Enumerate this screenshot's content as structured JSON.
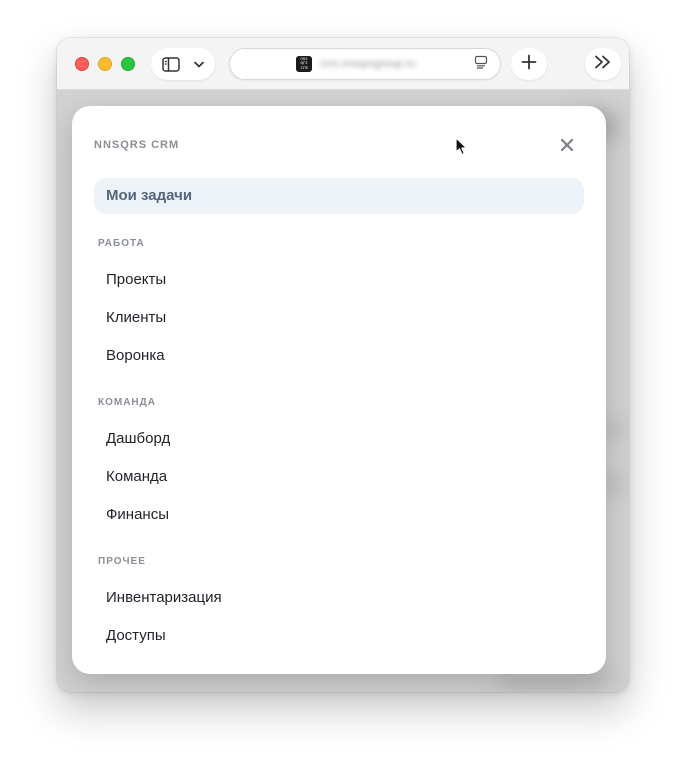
{
  "browser": {
    "address": "crm.nnsqrsgroup.ru",
    "favicon_text": "nns qrs crm"
  },
  "menu": {
    "brand": "NNSQRS CRM",
    "active_item": "Мои задачи",
    "sections": [
      {
        "label": "РАБОТА",
        "items": [
          "Проекты",
          "Клиенты",
          "Воронка"
        ]
      },
      {
        "label": "КОМАНДА",
        "items": [
          "Дашборд",
          "Команда",
          "Финансы"
        ]
      },
      {
        "label": "ПРОЧЕЕ",
        "items": [
          "Инвентаризация",
          "Доступы"
        ]
      }
    ]
  },
  "icons": {
    "close": "close-icon",
    "sidebar": "sidebar-icon",
    "chevron": "chevron-down-icon",
    "reader": "reader-icon",
    "plus": "plus-icon",
    "more_tabs": "double-chevron-right-icon",
    "cursor": "mouse-pointer-icon"
  },
  "colors": {
    "active_bg": "#eef3f8",
    "active_text": "#52677d",
    "section_label": "#8a8f96",
    "item_text": "#1f2328"
  }
}
